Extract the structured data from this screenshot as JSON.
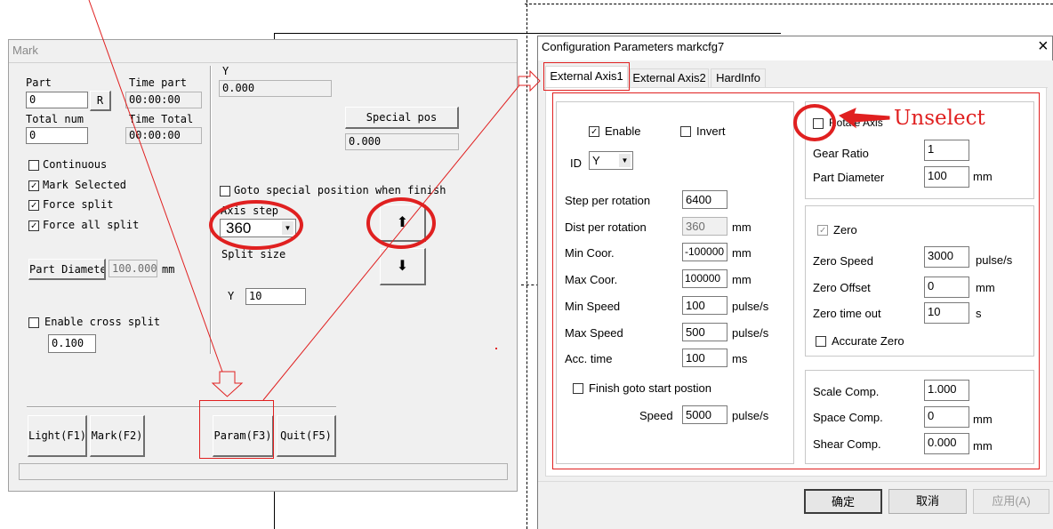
{
  "mark": {
    "title": "Mark",
    "part_label": "Part",
    "part_value": "0",
    "r_button": "R",
    "time_part_label": "Time part",
    "time_part_value": "00:00:00",
    "total_num_label": "Total num",
    "total_num_value": "0",
    "time_total_label": "Time Total",
    "time_total_value": "00:00:00",
    "y_label": "Y",
    "y_value": "0.000",
    "special_pos_button": "Special pos",
    "special_pos_value": "0.000",
    "continuous": {
      "label": "Continuous",
      "checked": false
    },
    "mark_selected": {
      "label": "Mark Selected",
      "checked": true
    },
    "force_split": {
      "label": "Force split",
      "checked": true
    },
    "force_all_split": {
      "label": "Force all split",
      "checked": true
    },
    "goto_special": {
      "label": "Goto special position when finish",
      "checked": false
    },
    "axis_step_label": "Axis step",
    "axis_step_value": "360",
    "split_size_label": "Split size",
    "split_y_label": "Y",
    "split_y_value": "10",
    "up_arrow": "⬆",
    "down_arrow": "⬇",
    "part_diameter_button": "Part Diameter",
    "part_diameter_value": "100.000",
    "part_diameter_unit": "mm",
    "enable_cross_split": {
      "label": "Enable cross split",
      "checked": false
    },
    "cross_split_value": "0.100",
    "buttons": {
      "light": "Light(F1)",
      "mark": "Mark(F2)",
      "param": "Param(F3)",
      "quit": "Quit(F5)"
    }
  },
  "config": {
    "title": "Configuration Parameters markcfg7",
    "close": "×",
    "tabs": [
      "External Axis1",
      "External Axis2",
      "HardInfo"
    ],
    "enable": {
      "label": "Enable",
      "checked": true
    },
    "invert": {
      "label": "Invert",
      "checked": false
    },
    "id_label": "ID",
    "id_value": "Y",
    "params": [
      {
        "label": "Step per rotation",
        "value": "6400",
        "unit": "",
        "disabled": false
      },
      {
        "label": "Dist per rotation",
        "value": "360",
        "unit": "mm",
        "disabled": true
      },
      {
        "label": "Min Coor.",
        "value": "-100000",
        "unit": "mm",
        "disabled": false
      },
      {
        "label": "Max Coor.",
        "value": "100000",
        "unit": "mm",
        "disabled": false
      },
      {
        "label": "Min Speed",
        "value": "100",
        "unit": "pulse/s",
        "disabled": false
      },
      {
        "label": "Max Speed",
        "value": "500",
        "unit": "pulse/s",
        "disabled": false
      },
      {
        "label": "Acc. time",
        "value": "100",
        "unit": "ms",
        "disabled": false
      }
    ],
    "finish_goto": {
      "label": "Finish goto start postion",
      "checked": false
    },
    "speed_label": "Speed",
    "speed_value": "5000",
    "speed_unit": "pulse/s",
    "rotate_axis": {
      "label": "Rotate Axis",
      "checked": false
    },
    "gear_ratio_label": "Gear Ratio",
    "gear_ratio_value": "1",
    "part_diameter_label": "Part Diameter",
    "part_diameter_value": "100",
    "part_diameter_unit": "mm",
    "zero": {
      "label": "Zero",
      "checked": true
    },
    "zero_speed_label": "Zero Speed",
    "zero_speed_value": "3000",
    "zero_speed_unit": "pulse/s",
    "zero_offset_label": "Zero Offset",
    "zero_offset_value": "0",
    "zero_offset_unit": "mm",
    "zero_timeout_label": "Zero time out",
    "zero_timeout_value": "10",
    "zero_timeout_unit": "s",
    "accurate_zero": {
      "label": "Accurate Zero",
      "checked": false
    },
    "scale_comp_label": "Scale Comp.",
    "scale_comp_value": "1.000",
    "space_comp_label": "Space Comp.",
    "space_comp_value": "0",
    "space_comp_unit": "mm",
    "shear_comp_label": "Shear Comp.",
    "shear_comp_value": "0.000",
    "shear_comp_unit": "mm",
    "ok_button": "确定",
    "cancel_button": "取消",
    "apply_button": "应用(A)"
  },
  "annotation": {
    "unselect_text": "Unselect",
    "color": "#e02020"
  }
}
